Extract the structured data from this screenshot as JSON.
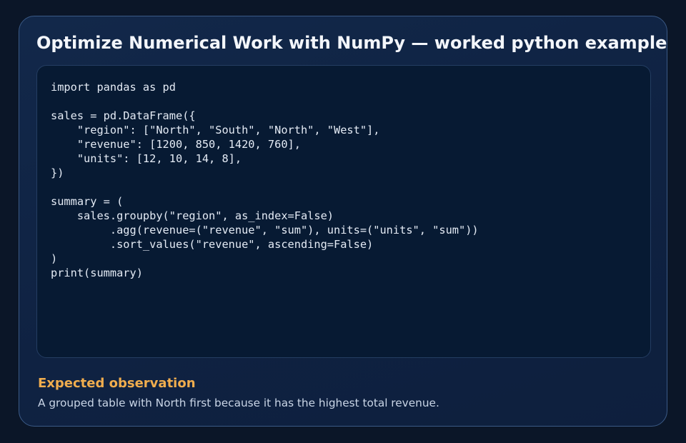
{
  "title": "Optimize Numerical Work with NumPy — worked python example",
  "code": {
    "language": "python",
    "lines": [
      "import pandas as pd",
      "",
      "sales = pd.DataFrame({",
      "    \"region\": [\"North\", \"South\", \"North\", \"West\"],",
      "    \"revenue\": [1200, 850, 1420, 760],",
      "    \"units\": [12, 10, 14, 8],",
      "})",
      "",
      "summary = (",
      "    sales.groupby(\"region\", as_index=False)",
      "         .agg(revenue=(\"revenue\", \"sum\"), units=(\"units\", \"sum\"))",
      "         .sort_values(\"revenue\", ascending=False)",
      ")",
      "print(summary)"
    ]
  },
  "observation": {
    "heading": "Expected observation",
    "text": "A grouped table with North first because it has the highest total revenue."
  },
  "colors": {
    "background": "#0b1628",
    "card": "#10244a",
    "card_border": "#3b5a86",
    "code_panel": "#071a33",
    "code_text": "#e4ebf5",
    "heading_accent": "#f0ad4e",
    "body_text": "#c9d5e6"
  }
}
